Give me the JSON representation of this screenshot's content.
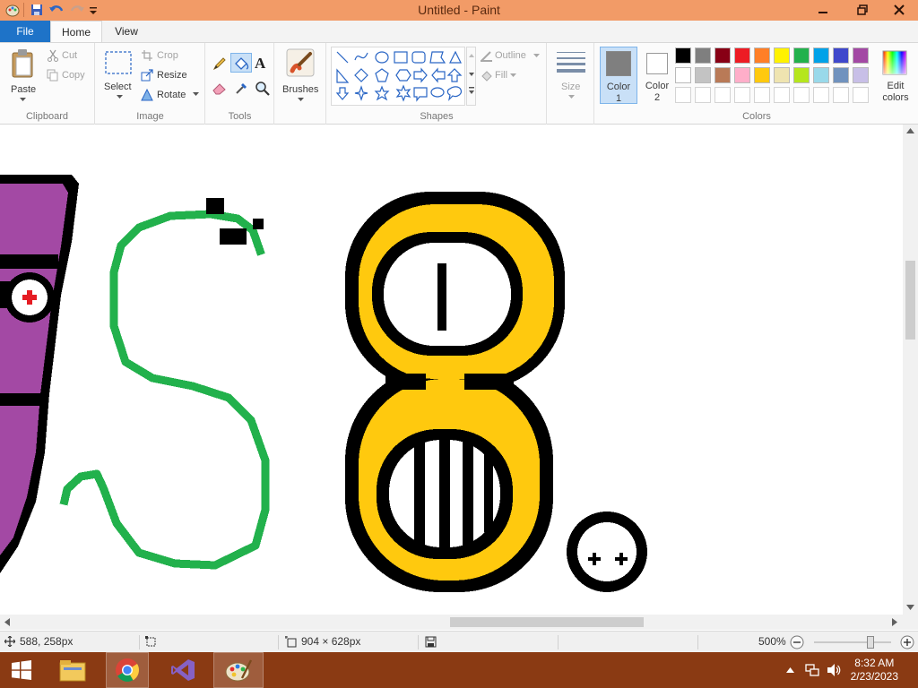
{
  "window": {
    "title": "Untitled - Paint",
    "minimize_icon": "minimize-icon",
    "restore_icon": "restore-icon",
    "close_icon": "close-icon"
  },
  "tabs": {
    "file": "File",
    "home": "Home",
    "view": "View"
  },
  "clipboard": {
    "label": "Clipboard",
    "paste": "Paste",
    "cut": "Cut",
    "copy": "Copy"
  },
  "image": {
    "label": "Image",
    "select": "Select",
    "crop": "Crop",
    "resize": "Resize",
    "rotate": "Rotate"
  },
  "tools": {
    "label": "Tools"
  },
  "brushes": {
    "label": "Brushes"
  },
  "shapes": {
    "label": "Shapes",
    "outline": "Outline",
    "fill": "Fill"
  },
  "size": {
    "label": "Size"
  },
  "colors": {
    "label": "Colors",
    "color1_line1": "Color",
    "color1_line2": "1",
    "color2_line1": "Color",
    "color2_line2": "2",
    "edit_line1": "Edit",
    "edit_line2": "colors",
    "color1_value": "#7f7f7f",
    "color2_value": "#ffffff",
    "palette_row1": [
      "#000000",
      "#7f7f7f",
      "#880015",
      "#ed1c24",
      "#ff7f27",
      "#fff200",
      "#22b14c",
      "#00a2e8",
      "#3f48cc",
      "#a349a4"
    ],
    "palette_row2": [
      "#ffffff",
      "#c3c3c3",
      "#b97a57",
      "#ffaec9",
      "#ffc90e",
      "#efe4b0",
      "#b5e61d",
      "#99d9ea",
      "#7092be",
      "#c8bfe7"
    ]
  },
  "status": {
    "cursor_pos": "588, 258px",
    "canvas_size": "904 × 628px",
    "zoom": "500%"
  },
  "taskbar": {
    "time": "8:32 AM",
    "date": "2/23/2023"
  }
}
